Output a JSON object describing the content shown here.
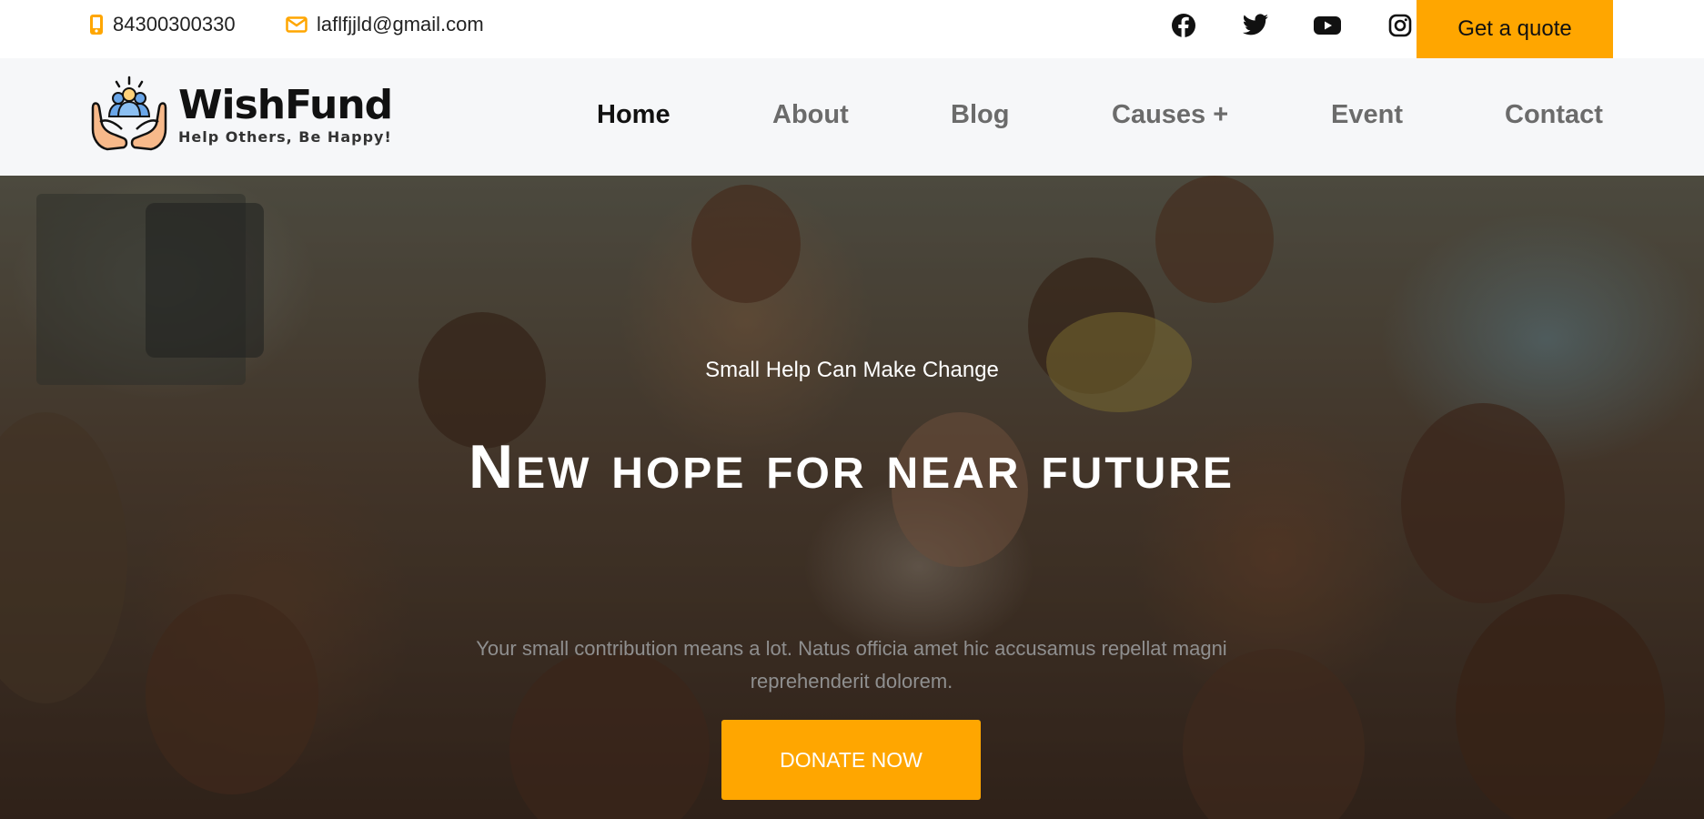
{
  "topbar": {
    "phone": "84300300330",
    "email": "laflfjjld@gmail.com",
    "social": [
      {
        "icon": "facebook-icon"
      },
      {
        "icon": "twitter-icon"
      },
      {
        "icon": "youtube-icon"
      },
      {
        "icon": "instagram-icon"
      }
    ],
    "quote_label": "Get a quote"
  },
  "logo": {
    "name": "WishFund",
    "tagline": "Help Others, Be Happy!"
  },
  "nav": {
    "items": [
      {
        "label": "Home",
        "active": true
      },
      {
        "label": "About"
      },
      {
        "label": "Blog"
      },
      {
        "label": "Causes +"
      },
      {
        "label": "Event"
      },
      {
        "label": "Contact"
      }
    ]
  },
  "hero": {
    "subtitle": "Small Help Can Make Change",
    "title": "New hope for near future",
    "description": "Your small contribution means a lot. Natus officia amet hic accusamus repellat magni reprehenderit dolorem.",
    "cta_label": "DONATE NOW"
  },
  "colors": {
    "accent": "#ffa600",
    "nav_bg": "#f6f7f9"
  }
}
